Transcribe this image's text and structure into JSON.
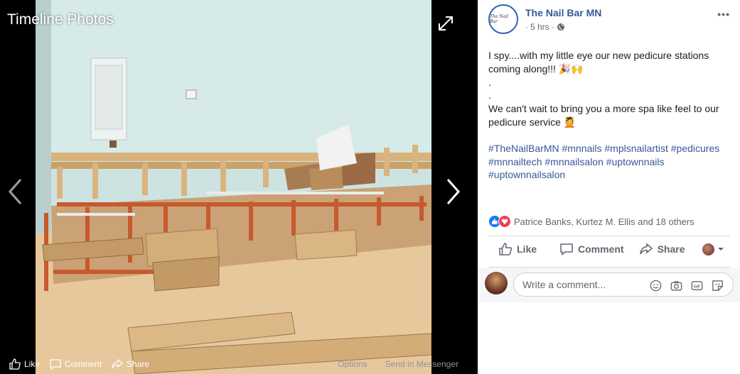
{
  "viewer": {
    "title": "Timeline Photos",
    "actions": {
      "like": "Like",
      "comment": "Comment",
      "share": "Share",
      "options": "Options",
      "send": "Send in Messenger"
    }
  },
  "post": {
    "page_name": "The Nail Bar MN",
    "avatar_text": "The Nail Bar",
    "time": "5 hrs",
    "body_line1": "I spy....with my little eye our new pedicure stations coming along!!! 🎉🙌",
    "dot1": ".",
    "dot2": ".",
    "body_line2": "We can't wait to bring you a more spa like feel to our pedicure service 💆",
    "hashtags": "#TheNailBarMN #mnnails #mplsnailartist #pedicures #mnnailtech #mnnailsalon #uptownnails #uptownnailsalon",
    "reactions_text": "Patrice Banks, Kurtez M. Ellis and 18 others",
    "more_icon": "•••"
  },
  "actions": {
    "like": "Like",
    "comment": "Comment",
    "share": "Share"
  },
  "comment": {
    "placeholder": "Write a comment..."
  },
  "colors": {
    "link": "#385898",
    "like": "#1877f2",
    "love": "#f33e58"
  }
}
